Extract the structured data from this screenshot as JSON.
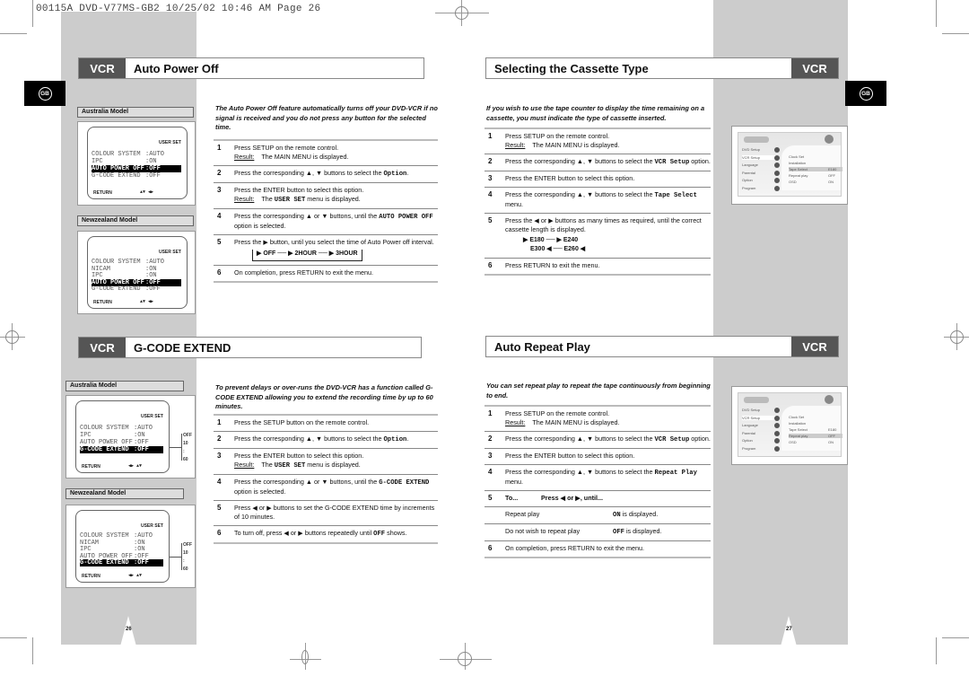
{
  "print_header": "00115A DVD-V77MS-GB2   10/25/02 10:46 AM   Page 26",
  "language_badge": "GB",
  "vcr_tag": "VCR",
  "auto_power_off": {
    "title": "Auto Power Off",
    "intro": "The Auto Power Off feature automatically turns off your DVD-VCR if no signal is received and you do not press any button for the selected time.",
    "models": [
      {
        "label": "Australia Model",
        "header": "USER SET",
        "rows": [
          [
            "COLOUR SYSTEM",
            ":AUTO"
          ],
          [
            "IPC",
            ":ON"
          ],
          [
            "AUTO POWER OFF",
            ":OFF"
          ],
          [
            "G-CODE EXTEND",
            ":OFF"
          ]
        ],
        "selected": 2,
        "return": "RETURN",
        "nav": "▲▼ ◀▶"
      },
      {
        "label": "Newzealand Model",
        "header": "USER SET",
        "rows": [
          [
            "COLOUR SYSTEM",
            ":AUTO"
          ],
          [
            "NICAM",
            ":ON"
          ],
          [
            "IPC",
            ":ON"
          ],
          [
            "AUTO POWER OFF",
            ":OFF"
          ],
          [
            "G-CODE EXTEND",
            ":OFF"
          ]
        ],
        "selected": 3,
        "return": "RETURN",
        "nav": "▲▼ ◀▶"
      }
    ],
    "steps": [
      {
        "n": "1",
        "text": "Press SETUP on the remote control.",
        "result_label": "Result:",
        "result": "The MAIN MENU is displayed."
      },
      {
        "n": "2",
        "pre": "Press the corresponding ▲, ▼ buttons to select the ",
        "code": "Option",
        "post": "."
      },
      {
        "n": "3",
        "text": "Press the ENTER button to select this option.",
        "result_label": "Result:",
        "result_pre": "The ",
        "result_code": "USER SET",
        "result_post": " menu is displayed."
      },
      {
        "n": "4",
        "pre": "Press the corresponding ▲ or ▼ buttons, until the ",
        "code": "AUTO POWER OFF",
        "post": " option is selected."
      },
      {
        "n": "5",
        "text": "Press the ▶ button, until you select the time of Auto Power off interval.",
        "cycle": "▶ OFF ── ▶ 2HOUR ── ▶ 3HOUR"
      },
      {
        "n": "6",
        "text": "On completion, press RETURN to exit the menu."
      }
    ]
  },
  "gcode_extend": {
    "title": "G-CODE EXTEND",
    "intro": "To prevent delays or over-runs the DVD-VCR has a function called G-CODE EXTEND allowing you to extend the recording time by up to 60 minutes.",
    "scale": [
      "OFF",
      "10",
      ":",
      "60"
    ],
    "models": [
      {
        "label": "Australia Model",
        "header": "USER SET",
        "rows": [
          [
            "COLOUR SYSTEM",
            ":AUTO"
          ],
          [
            "IPC",
            ":ON"
          ],
          [
            "AUTO POWER OFF",
            ":OFF"
          ],
          [
            "G-CODE EXTEND",
            ":OFF"
          ]
        ],
        "selected": 3,
        "return": "RETURN",
        "nav": "◀▶ ▲▼"
      },
      {
        "label": "Newzealand Model",
        "header": "USER SET",
        "rows": [
          [
            "COLOUR SYSTEM",
            ":AUTO"
          ],
          [
            "NICAM",
            ":ON"
          ],
          [
            "IPC",
            ":ON"
          ],
          [
            "AUTO POWER OFF",
            ":OFF"
          ],
          [
            "G-CODE EXTEND",
            ":OFF"
          ]
        ],
        "selected": 4,
        "return": "RETURN",
        "nav": "◀▶ ▲▼"
      }
    ],
    "steps": [
      {
        "n": "1",
        "text": "Press the SETUP button on the remote control."
      },
      {
        "n": "2",
        "pre": "Press the corresponding ▲, ▼ buttons to select the ",
        "code": "Option",
        "post": "."
      },
      {
        "n": "3",
        "text": "Press the ENTER button to select this option.",
        "result_label": "Result:",
        "result_pre": "The ",
        "result_code": "USER SET",
        "result_post": " menu is displayed."
      },
      {
        "n": "4",
        "pre": "Press the corresponding ▲ or ▼ buttons, until the ",
        "code": "G-CODE EXTEND",
        "post": " option is selected."
      },
      {
        "n": "5",
        "text": "Press ◀ or ▶ buttons to set the G-CODE EXTEND time by increments of 10 minutes."
      },
      {
        "n": "6",
        "pre": "To turn off, press ◀ or ▶ buttons repeatedly until ",
        "code": "OFF",
        "post": " shows."
      }
    ]
  },
  "cassette_type": {
    "title": "Selecting the Cassette Type",
    "intro": "If you wish to use the tape counter to display the time remaining on a cassette, you must indicate the type of cassette inserted.",
    "steps": [
      {
        "n": "1",
        "text": "Press SETUP on the remote control.",
        "result_label": "Result:",
        "result": "The MAIN MENU is displayed."
      },
      {
        "n": "2",
        "pre": "Press the corresponding ▲, ▼ buttons to select the ",
        "code": "VCR Setup",
        "post": " option."
      },
      {
        "n": "3",
        "text": "Press the ENTER button to select this option."
      },
      {
        "n": "4",
        "pre": "Press the corresponding ▲, ▼ buttons to select the ",
        "code": "Tape Select",
        "post": " menu."
      },
      {
        "n": "5",
        "text": "Press the ◀ or ▶ buttons as many times as required, until the correct cassette length is displayed.",
        "cycle_top": "▶ E180 ── ▶ E240",
        "cycle_bottom": "E300 ◀ ── E260 ◀"
      },
      {
        "n": "6",
        "text": "Press RETURN to exit the menu."
      }
    ],
    "menu": {
      "left": [
        "DVD Setup",
        "VCR Setup",
        "Language",
        "Parental",
        "Option",
        "Program"
      ],
      "right": [
        [
          "Clock Set",
          ""
        ],
        [
          "Installation",
          ""
        ],
        [
          "Tape Select",
          "E180"
        ],
        [
          "Repeat play",
          "OFF"
        ],
        [
          "OSD",
          "ON"
        ]
      ],
      "highlight": 2
    }
  },
  "auto_repeat": {
    "title": "Auto Repeat Play",
    "intro": "You can set repeat play to repeat the tape continuously from beginning to end.",
    "steps": [
      {
        "n": "1",
        "text": "Press SETUP on the remote control.",
        "result_label": "Result:",
        "result": "The MAIN MENU is displayed."
      },
      {
        "n": "2",
        "pre": "Press the corresponding ▲, ▼ buttons to select the ",
        "code": "VCR Setup",
        "post": " option."
      },
      {
        "n": "3",
        "text": "Press the ENTER button to select this option."
      },
      {
        "n": "4",
        "pre": "Press the corresponding ▲, ▼ buttons to select the ",
        "code": "Repeat Play",
        "post": " menu."
      }
    ],
    "table_header": {
      "n": "5",
      "to": "To...",
      "press": "Press ◀ or ▶, until..."
    },
    "table_rows": [
      {
        "to": "Repeat play",
        "code": "ON",
        "post": " is displayed."
      },
      {
        "to": "Do not wish to repeat play",
        "code": "OFF",
        "post": " is displayed."
      }
    ],
    "final_step": {
      "n": "6",
      "text": "On completion, press RETURN to exit the menu."
    },
    "menu": {
      "left": [
        "DVD Setup",
        "VCR Setup",
        "Language",
        "Parental",
        "Option",
        "Program"
      ],
      "right": [
        [
          "Clock Set",
          ""
        ],
        [
          "Installation",
          ""
        ],
        [
          "Tape Select",
          "E180"
        ],
        [
          "Repeat play",
          "OFF"
        ],
        [
          "OSD",
          "ON"
        ]
      ],
      "highlight": 3
    }
  },
  "page_numbers": {
    "left": "26",
    "right": "27"
  }
}
